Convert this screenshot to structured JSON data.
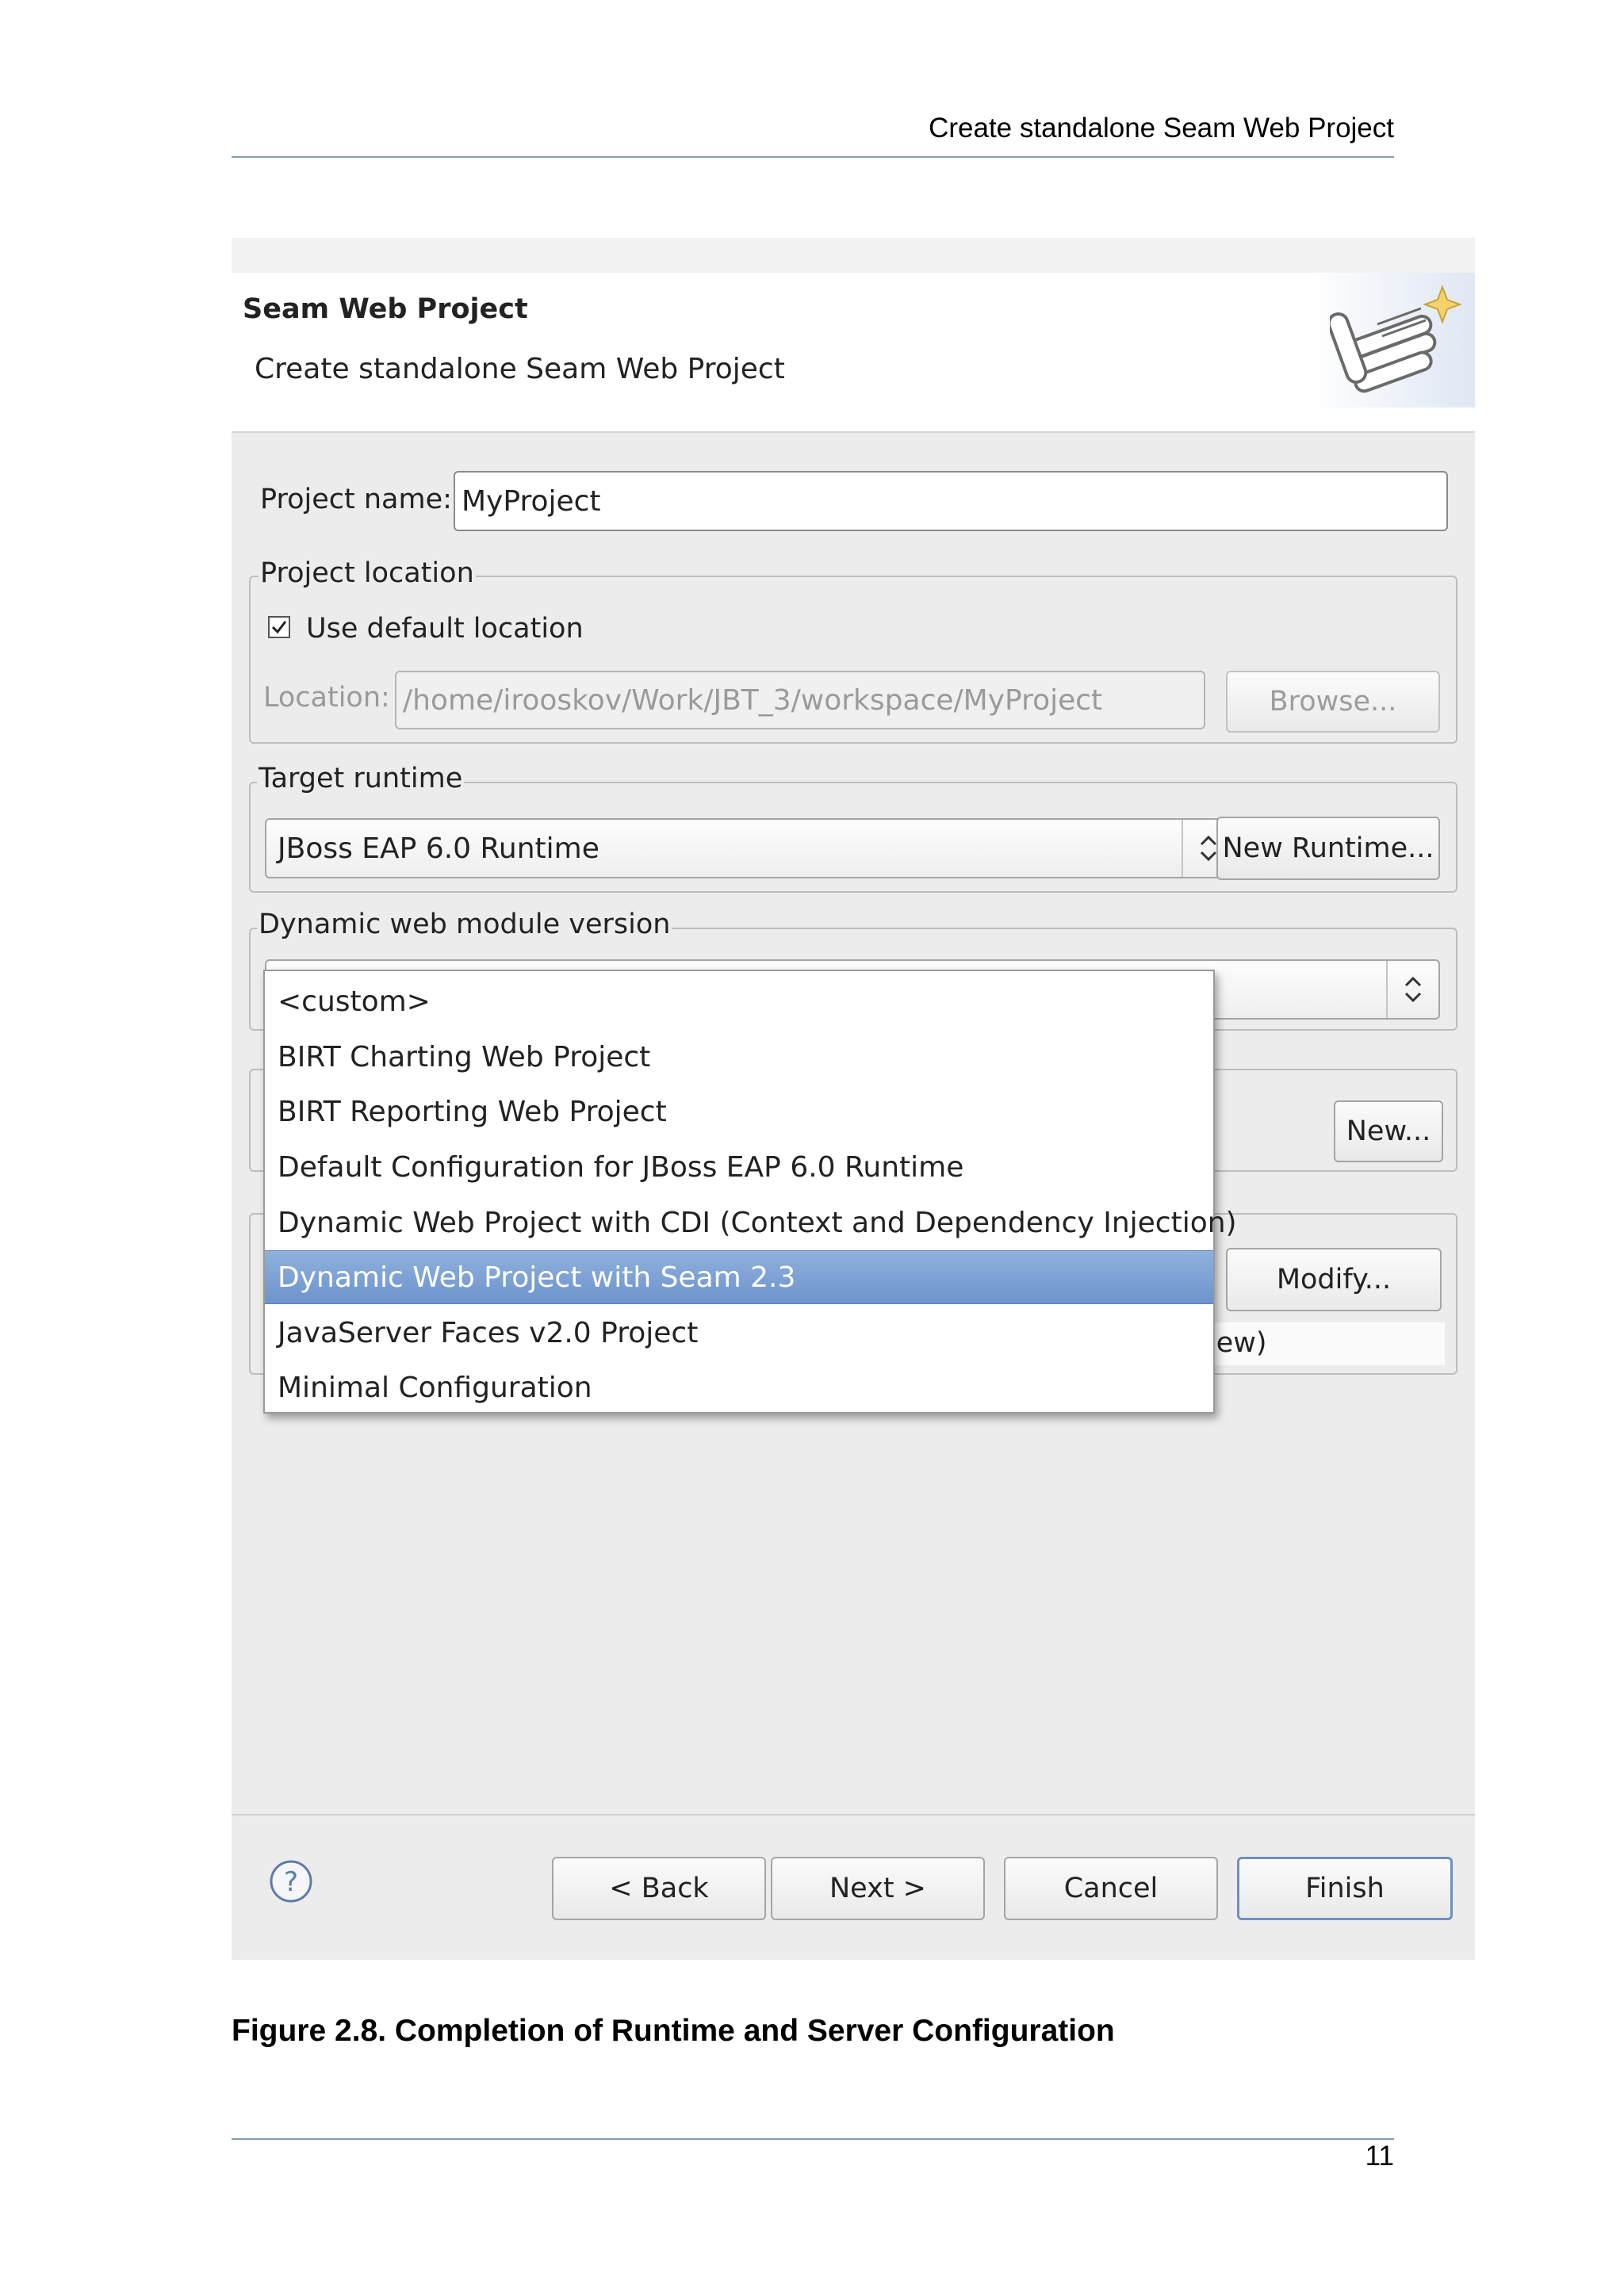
{
  "page_header": "Create standalone Seam Web Project",
  "wizard": {
    "title": "Seam Web Project",
    "description": "Create standalone Seam Web Project",
    "banner_icon": "seam-wizard-icon"
  },
  "project_name": {
    "label": "Project name:",
    "value": "MyProject"
  },
  "project_location": {
    "group_label": "Project location",
    "use_default_label": "Use default location",
    "use_default_checked": true,
    "location_label": "Location:",
    "location_value": "/home/irooskov/Work/JBT_3/workspace/MyProject",
    "browse_label": "Browse..."
  },
  "target_runtime": {
    "group_label": "Target runtime",
    "selected": "JBoss EAP 6.0 Runtime",
    "new_button": "New Runtime..."
  },
  "dynamic_web_module": {
    "group_label": "Dynamic web module version"
  },
  "configuration": {
    "new_button": "New...",
    "modify_button": "Modify...",
    "partial_text": "iew)"
  },
  "dropdown": {
    "items": [
      "<custom>",
      "BIRT Charting Web Project",
      "BIRT Reporting Web Project",
      "Default Configuration for JBoss EAP 6.0 Runtime",
      "Dynamic Web Project with CDI (Context and Dependency Injection)",
      "Dynamic Web Project with Seam 2.3",
      "JavaServer Faces v2.0 Project",
      "Minimal Configuration"
    ],
    "selected_index": 5
  },
  "buttons": {
    "back": "< Back",
    "next": "Next >",
    "cancel": "Cancel",
    "finish": "Finish"
  },
  "caption": "Figure 2.8. Completion of Runtime and Server Configuration",
  "page_number": "11",
  "colors": {
    "selection": "#7aa0d4",
    "background": "#ececec"
  }
}
